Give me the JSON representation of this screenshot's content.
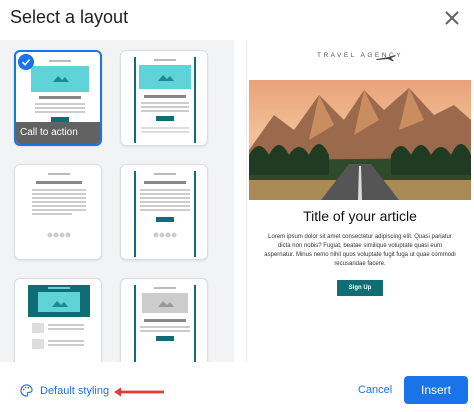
{
  "dialog": {
    "title": "Select a layout",
    "close_icon": "close-icon"
  },
  "layouts": [
    {
      "label": "Call to action",
      "selected": true
    },
    {
      "label": "",
      "selected": false
    },
    {
      "label": "",
      "selected": false
    },
    {
      "label": "",
      "selected": false
    },
    {
      "label": "",
      "selected": false
    },
    {
      "label": "",
      "selected": false
    }
  ],
  "preview": {
    "brand": "TRAVEL AGENCY",
    "title": "Title of your article",
    "body": "Lorem ipsum dolor sit amet consectetur adipiscing elit. Quasi pariatur dicta non nobis? Fugiat, beatae similique voluptate quasi eum aspernatur. Minus nemo nihil quos voluptate fugit fuga ut quae commodi recusandae facere.",
    "button": "Sign Up"
  },
  "footer": {
    "styling_label": "Default styling",
    "cancel_label": "Cancel",
    "insert_label": "Insert"
  },
  "colors": {
    "accent": "#1a73e8",
    "teal": "#0e6e73",
    "teal_light": "#5fd3d8",
    "annotation_arrow": "#e53935"
  }
}
